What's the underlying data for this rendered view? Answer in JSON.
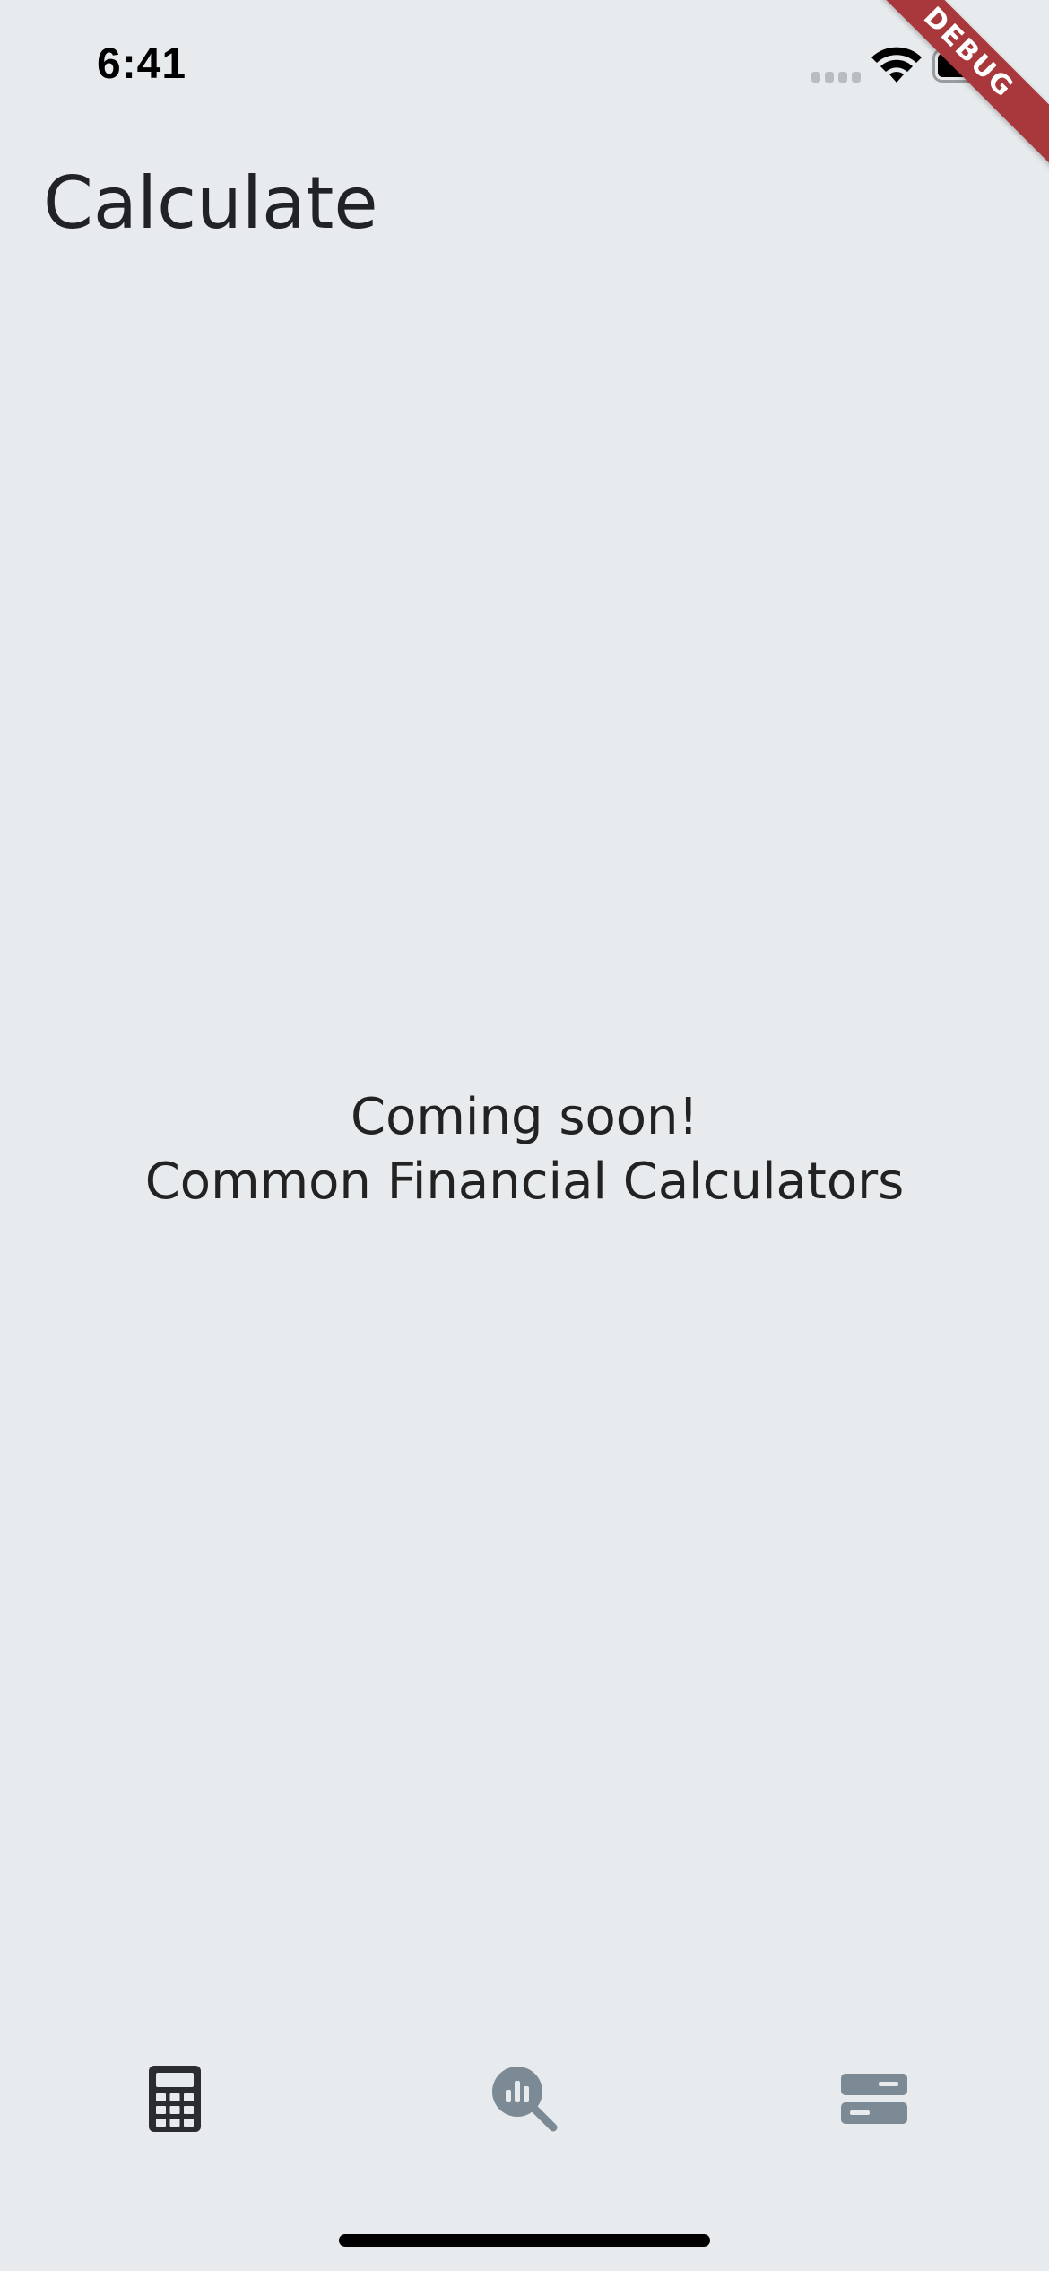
{
  "status_bar": {
    "time": "6:41"
  },
  "debug_banner": {
    "label": "DEBUG"
  },
  "header": {
    "title": "Calculate"
  },
  "main": {
    "message_line1": "Coming soon!",
    "message_line2": "Common Financial Calculators"
  },
  "bottom_nav": {
    "items": [
      {
        "icon": "calculator-icon",
        "active": true,
        "color": "#2A2C2F"
      },
      {
        "icon": "analytics-search-icon",
        "active": false,
        "color": "#7B8A95"
      },
      {
        "icon": "storage-icon",
        "active": false,
        "color": "#7B8A95"
      }
    ]
  },
  "colors": {
    "background": "#E8EBED",
    "text": "#202225",
    "debug_ribbon": "#A8383B"
  }
}
